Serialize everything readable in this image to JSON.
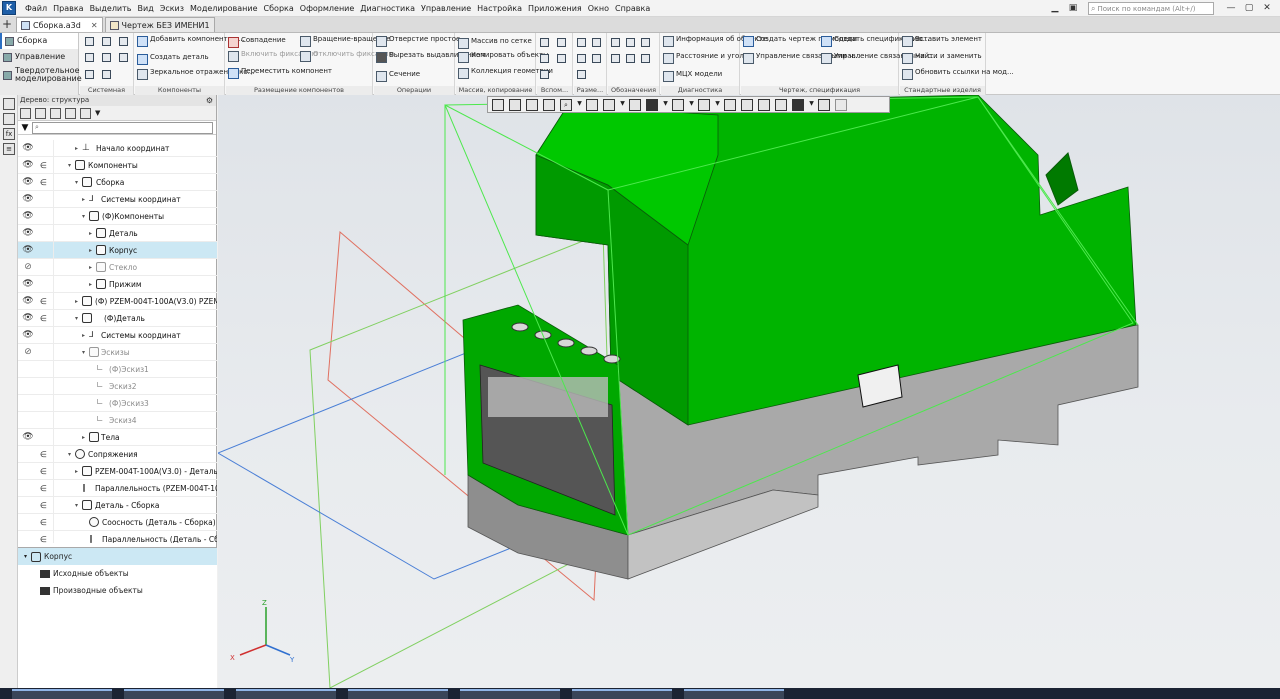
{
  "menu": {
    "items": [
      "Файл",
      "Правка",
      "Выделить",
      "Вид",
      "Эскиз",
      "Моделирование",
      "Сборка",
      "Оформление",
      "Диагностика",
      "Управление",
      "Настройка",
      "Приложения",
      "Окно",
      "Справка"
    ],
    "search_placeholder": "Поиск по командам (Alt+/)"
  },
  "tabs": [
    {
      "label": "Сборка.a3d",
      "active": true
    },
    {
      "label": "Чертеж БЕЗ ИМЕНИ1",
      "active": false
    }
  ],
  "modes": [
    "Сборка",
    "Управление",
    "Твердотельное моделирование"
  ],
  "ribbon": {
    "groups": [
      "Системная",
      "Компоненты",
      "Размещение компонентов",
      "Операции",
      "Массив, копирование",
      "Вспом...",
      "Разме...",
      "Обозначения",
      "Диагностика",
      "Чертеж, спецификация",
      "Стандартные изделия"
    ],
    "buttons": {
      "add_component": "Добавить компонент из...",
      "create_part": "Создать деталь",
      "mirror": "Зеркальное отражение ко...",
      "coincide": "Совпадение",
      "enable_fix": "Включить фиксацию",
      "move": "Переместить компонент",
      "rotate": "Вращение-вращение",
      "disable_fix": "Отключить фиксацию",
      "hole": "Отверстие простое",
      "cut_extrude": "Вырезать выдавливанием",
      "section": "Сечение",
      "grid_array": "Массив по сетке",
      "copy_objects": "Копировать объекты",
      "geometry_collection": "Коллекция геометрии",
      "object_info": "Информация об объекте",
      "distance_angle": "Расстояние и угол",
      "mass_props": "МЦХ модели",
      "create_drawing": "Создать чертеж по модели",
      "manage_linked": "Управление связанными ч...",
      "create_spec": "Создать спецификацию...",
      "manage_linked_spec": "Управление связанными с...",
      "insert_element": "Вставить элемент",
      "find_replace": "Найти и заменить",
      "update_links": "Обновить ссылки на мод..."
    }
  },
  "tree": {
    "header": "Дерево: структура",
    "filter_placeholder": "",
    "rows": [
      {
        "label": "Начало координат",
        "dim": false,
        "selected": false
      },
      {
        "label": "Компоненты",
        "dim": false,
        "selected": false
      },
      {
        "label": "Сборка",
        "dim": false,
        "selected": false
      },
      {
        "label": "Системы координат",
        "dim": false,
        "selected": false
      },
      {
        "label": "(Ф)Компоненты",
        "dim": false,
        "selected": false
      },
      {
        "label": "Деталь",
        "dim": false,
        "selected": false
      },
      {
        "label": "Корпус",
        "dim": false,
        "selected": true
      },
      {
        "label": "Стекло",
        "dim": true,
        "selected": false
      },
      {
        "label": "Прижим",
        "dim": false,
        "selected": false
      },
      {
        "label": "(Ф) PZEM-004T-100A(V3.0) PZEM-00",
        "dim": false,
        "selected": false
      },
      {
        "label": "(Ф)Деталь",
        "dim": false,
        "selected": false
      },
      {
        "label": "Системы координат",
        "dim": false,
        "selected": false
      },
      {
        "label": "Эскизы",
        "dim": true,
        "selected": false
      },
      {
        "label": "(Ф)Эскиз1",
        "dim": true,
        "selected": false
      },
      {
        "label": "Эскиз2",
        "dim": true,
        "selected": false
      },
      {
        "label": "(Ф)Эскиз3",
        "dim": true,
        "selected": false
      },
      {
        "label": "Эскиз4",
        "dim": true,
        "selected": false
      },
      {
        "label": "Тела",
        "dim": false,
        "selected": false
      },
      {
        "label": "Сопряжения",
        "dim": false,
        "selected": false
      },
      {
        "label": "PZEM-004T-100A(V3.0) - Деталь",
        "dim": false,
        "selected": false
      },
      {
        "label": "Параллельность (PZEM-004T-100...",
        "dim": false,
        "selected": false
      },
      {
        "label": "Деталь - Сборка",
        "dim": false,
        "selected": false
      },
      {
        "label": "Соосность (Деталь - Сборка)",
        "dim": false,
        "selected": false
      },
      {
        "label": "Параллельность (Деталь - Сб...",
        "dim": false,
        "selected": false
      }
    ]
  },
  "props": {
    "title": "Корпус",
    "items": [
      "Исходные объекты",
      "Производные объекты"
    ]
  },
  "triad": {
    "x": "X",
    "y": "Y",
    "z": "Z"
  },
  "colors": {
    "model_green": "#00b400",
    "accent": "#2c6fc2",
    "selection": "#cce8f4",
    "plane_red": "#e07060",
    "plane_blue": "#4a7fd6"
  }
}
